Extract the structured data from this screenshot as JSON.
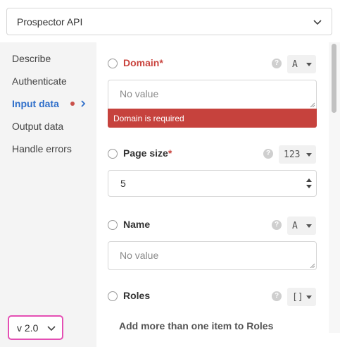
{
  "header": {
    "connector_name": "Prospector API"
  },
  "sidebar": {
    "items": [
      {
        "label": "Describe"
      },
      {
        "label": "Authenticate"
      },
      {
        "label": "Input data"
      },
      {
        "label": "Output data"
      },
      {
        "label": "Handle errors"
      }
    ],
    "version": "v 2.0"
  },
  "form": {
    "domain": {
      "label": "Domain",
      "required_mark": "*",
      "type": "A",
      "placeholder": "No value",
      "error": "Domain is required"
    },
    "page_size": {
      "label": "Page size",
      "required_mark": "*",
      "type": "123",
      "value": "5"
    },
    "name": {
      "label": "Name",
      "type": "A",
      "placeholder": "No value"
    },
    "roles": {
      "label": "Roles",
      "type": "[]",
      "hint": "Add more than one item to Roles"
    }
  },
  "colors": {
    "accent": "#2f6fca",
    "error": "#c6423d",
    "version_border": "#e44fb4"
  }
}
